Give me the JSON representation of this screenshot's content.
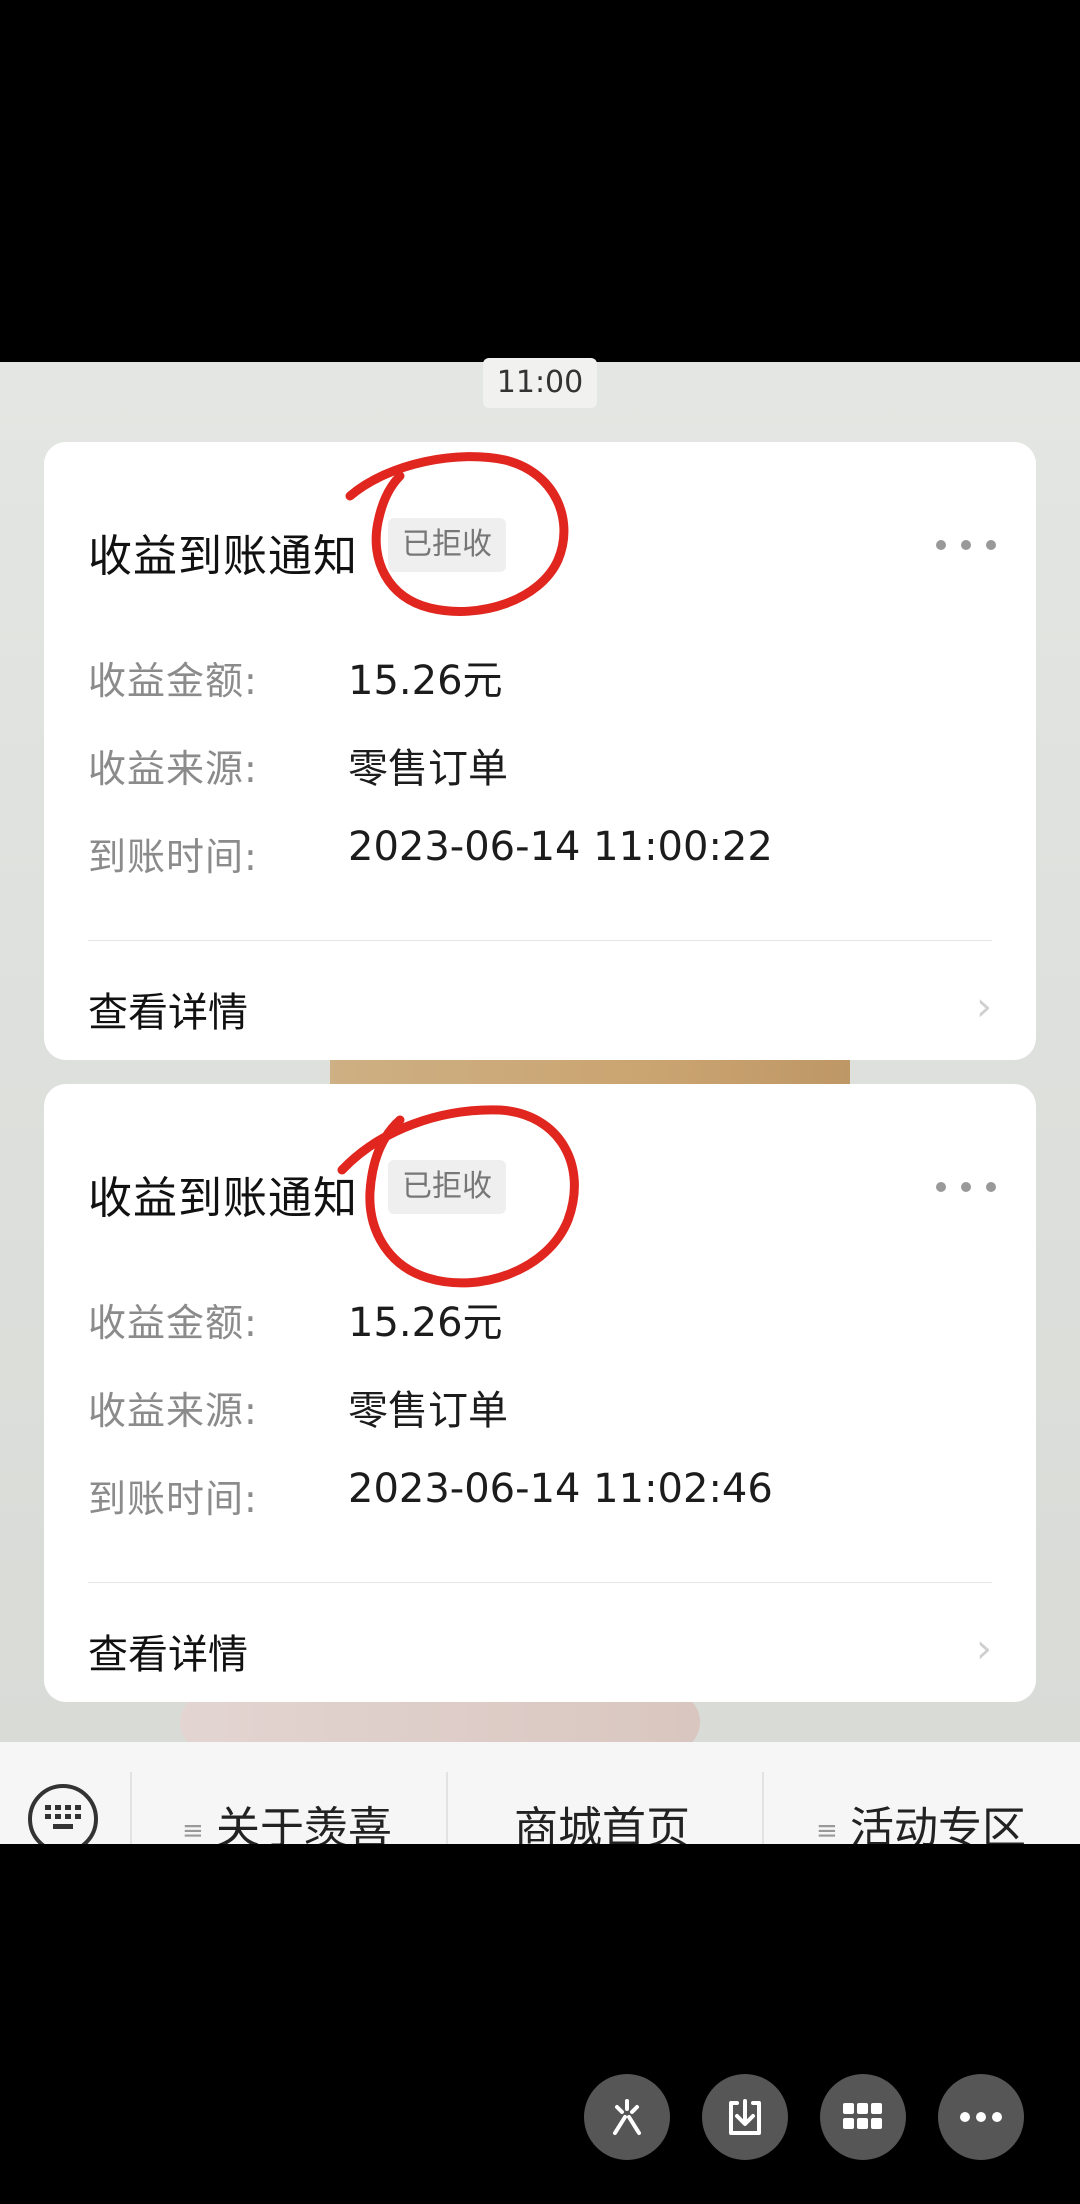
{
  "chat": {
    "time_label": "11:00"
  },
  "cards": [
    {
      "title": "收益到账通知",
      "badge": "已拒收",
      "rows": [
        {
          "label": "收益金额:",
          "value": "15.26元"
        },
        {
          "label": "收益来源:",
          "value": "零售订单"
        },
        {
          "label": "到账时间:",
          "value": "2023-06-14 11:00:22"
        }
      ],
      "detail_link": "查看详情"
    },
    {
      "title": "收益到账通知",
      "badge": "已拒收",
      "rows": [
        {
          "label": "收益金额:",
          "value": "15.26元"
        },
        {
          "label": "收益来源:",
          "value": "零售订单"
        },
        {
          "label": "到账时间:",
          "value": "2023-06-14 11:02:46"
        }
      ],
      "detail_link": "查看详情"
    }
  ],
  "menu": {
    "items": [
      {
        "label": "关于羡喜",
        "icon": "menu-icon"
      },
      {
        "label": "商城首页"
      },
      {
        "label": "活动专区",
        "icon": "menu-icon"
      }
    ]
  },
  "annotation_color": "#e0261e",
  "bottom_actions": [
    "share-icon",
    "download-icon",
    "apps-grid-icon",
    "more-icon"
  ]
}
